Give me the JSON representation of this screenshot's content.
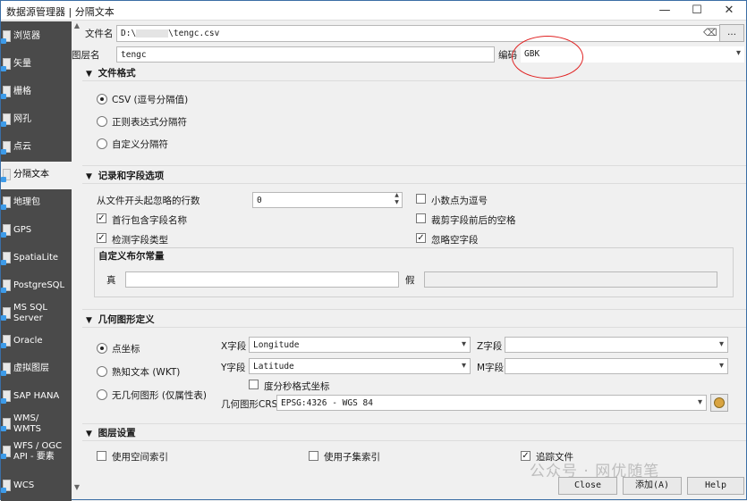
{
  "window": {
    "title": "数据源管理器 | 分隔文本",
    "minimize": "—",
    "maximize": "☐",
    "close": "✕"
  },
  "sidebar": {
    "items": [
      {
        "label": "浏览器"
      },
      {
        "label": "矢量"
      },
      {
        "label": "栅格"
      },
      {
        "label": "网孔"
      },
      {
        "label": "点云"
      },
      {
        "label": "分隔文本"
      },
      {
        "label": "地理包"
      },
      {
        "label": "GPS"
      },
      {
        "label": "SpatiaLite"
      },
      {
        "label": "PostgreSQL"
      },
      {
        "label": "MS SQL Server"
      },
      {
        "label": "Oracle"
      },
      {
        "label": "虚拟图层"
      },
      {
        "label": "SAP HANA"
      },
      {
        "label": "WMS/ WMTS"
      },
      {
        "label": "WFS / OGC API - 要素"
      },
      {
        "label": "WCS"
      }
    ]
  },
  "file": {
    "label": "文件名",
    "value_left": "D:\\",
    "value_right": "\\tengc.csv",
    "clear": "⌫",
    "browse": "…"
  },
  "layer": {
    "label": "图层名",
    "value": "tengc",
    "encoding_label": "编码",
    "encoding_value": "GBK"
  },
  "format": {
    "header": "文件格式",
    "options": [
      "CSV (逗号分隔值)",
      "正则表达式分隔符",
      "自定义分隔符"
    ]
  },
  "records": {
    "header": "记录和字段选项",
    "skip_label": "从文件开头起忽略的行数",
    "skip_value": "0",
    "first_record_names": "首行包含字段名称",
    "detect_types": "检测字段类型",
    "decimal_comma": "小数点为逗号",
    "trim_fields": "裁剪字段前后的空格",
    "discard_empty": "忽略空字段",
    "bool_header": "自定义布尔常量",
    "true_label": "真",
    "false_label": "假"
  },
  "geometry": {
    "header": "几何图形定义",
    "options": [
      "点坐标",
      "熟知文本 (WKT)",
      "无几何图形 (仅属性表)"
    ],
    "x_label": "X字段",
    "x_value": "Longitude",
    "y_label": "Y字段",
    "y_value": "Latitude",
    "z_label": "Z字段",
    "m_label": "M字段",
    "dms_label": "度分秒格式坐标",
    "crs_label": "几何图形CRS",
    "crs_value": "EPSG:4326 - WGS 84"
  },
  "layer_settings": {
    "header": "图层设置",
    "spatial_index": "使用空间索引",
    "subset_index": "使用子集索引",
    "watch_file": "追踪文件"
  },
  "buttons": {
    "close": "Close",
    "add": "添加(A)",
    "help": "Help"
  },
  "watermark": "公众号 · 网优随笔"
}
